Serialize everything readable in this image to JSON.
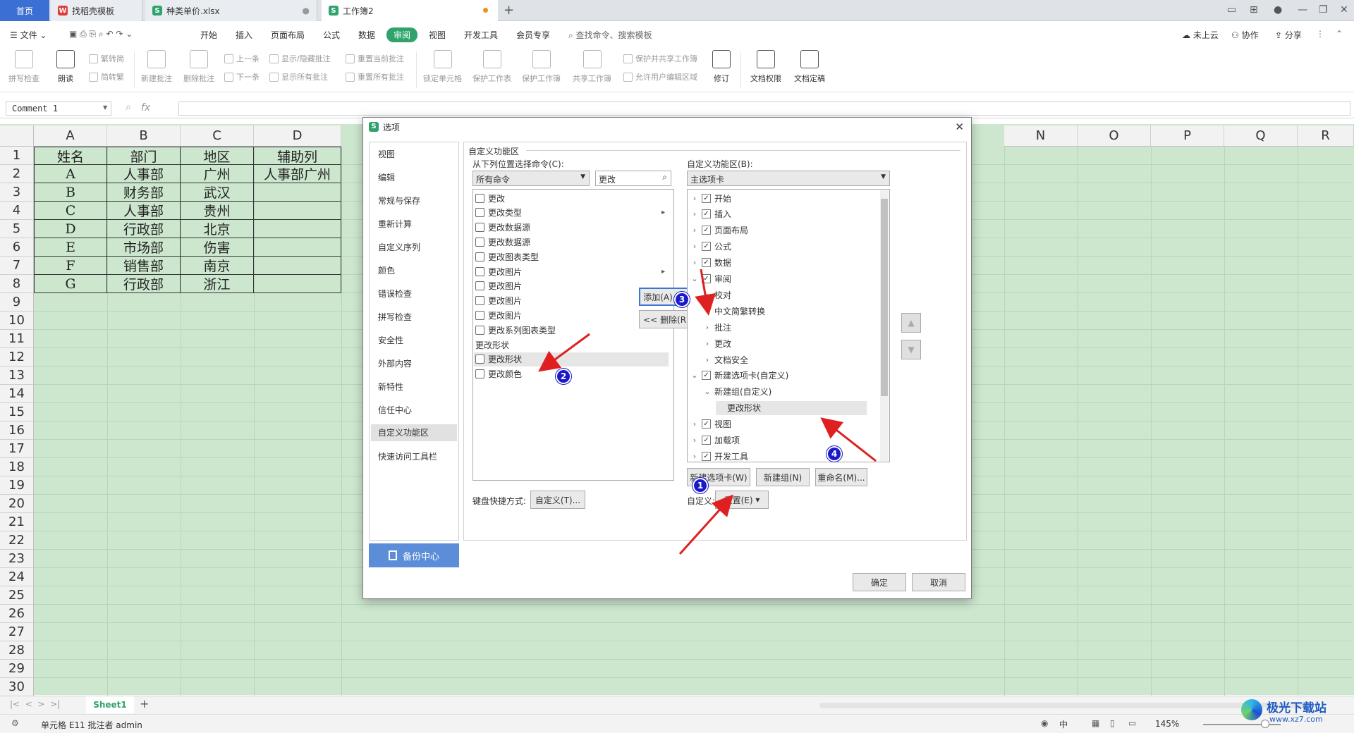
{
  "tabs": [
    {
      "label": "首页"
    },
    {
      "label": "找稻壳模板"
    },
    {
      "label": "种类单价.xlsx"
    },
    {
      "label": "工作簿2"
    }
  ],
  "menus": [
    "文件",
    "开始",
    "插入",
    "页面布局",
    "公式",
    "数据",
    "审阅",
    "视图",
    "开发工具",
    "会员专享"
  ],
  "search_hint": "查找命令、搜索模板",
  "top_right": {
    "cloud": "未上云",
    "collab": "协作",
    "share": "分享"
  },
  "ribbon": {
    "spell": "拼写检查",
    "read": "朗读",
    "trad": "繁转简",
    "simp": "简转繁",
    "new_comment": "新建批注",
    "del_comment": "删除批注",
    "prev": "上一条",
    "next": "下一条",
    "show_hide": "显示/隐藏批注",
    "show_all": "显示所有批注",
    "reset_cur": "重置当前批注",
    "reset_all": "重置所有批注",
    "lock_cell": "锁定单元格",
    "protect_sheet": "保护工作表",
    "protect_book": "保护工作簿",
    "share_book": "共享工作簿",
    "protect_share": "保护并共享工作簿",
    "allow_edit": "允许用户编辑区域",
    "revise": "修订",
    "doc_perm": "文档权限",
    "doc_final": "文档定稿"
  },
  "formula": {
    "namebox": "Comment 1",
    "fx": "fx"
  },
  "columns": [
    "A",
    "B",
    "C",
    "D",
    "N",
    "O",
    "P",
    "Q",
    "R"
  ],
  "rows": [
    "1",
    "2",
    "3",
    "4",
    "5",
    "6",
    "7",
    "8",
    "9",
    "10",
    "11",
    "12",
    "13",
    "14",
    "15",
    "16",
    "17",
    "18",
    "19",
    "20",
    "21",
    "22",
    "23",
    "24",
    "25",
    "26",
    "27",
    "28",
    "29",
    "30"
  ],
  "table": [
    [
      "姓名",
      "部门",
      "地区",
      "辅助列"
    ],
    [
      "A",
      "人事部",
      "广州",
      "人事部广州"
    ],
    [
      "B",
      "财务部",
      "武汉",
      ""
    ],
    [
      "C",
      "人事部",
      "贵州",
      ""
    ],
    [
      "D",
      "行政部",
      "北京",
      ""
    ],
    [
      "E",
      "市场部",
      "伤害",
      ""
    ],
    [
      "F",
      "销售部",
      "南京",
      ""
    ],
    [
      "G",
      "行政部",
      "浙江",
      ""
    ]
  ],
  "sheet_tab": "Sheet1",
  "status": {
    "cell": "单元格 E11 批注者 admin",
    "zoom": "145%",
    "ime": "中"
  },
  "watermark": {
    "name": "极光下载站",
    "url": "www.xz7.com"
  },
  "dialog": {
    "title": "选项",
    "nav": [
      "视图",
      "编辑",
      "常规与保存",
      "重新计算",
      "自定义序列",
      "颜色",
      "错误检查",
      "拼写检查",
      "安全性",
      "外部内容",
      "新特性",
      "信任中心",
      "自定义功能区",
      "快速访问工具栏"
    ],
    "backup": "备份中心",
    "section": "自定义功能区",
    "left_label": "从下列位置选择命令(C):",
    "left_combo": "所有命令",
    "left_search": "更改",
    "left_items": [
      "更改",
      "更改类型",
      "更改数据源",
      "更改数据源",
      "更改图表类型",
      "更改图片",
      "更改图片",
      "更改图片",
      "更改图片",
      "更改系列图表类型",
      "更改形状",
      "更改形状",
      "更改颜色"
    ],
    "right_label": "自定义功能区(B):",
    "right_combo": "主选项卡",
    "tree": [
      "开始",
      "插入",
      "页面布局",
      "公式",
      "数据",
      "审阅",
      "校对",
      "中文简繁转换",
      "批注",
      "更改",
      "文档安全",
      "新建选项卡(自定义)",
      "新建组(自定义)",
      "更改形状",
      "视图",
      "加载项",
      "开发工具"
    ],
    "add": "添加(A) >>",
    "remove": "<< 删除(R)",
    "new_tab": "新建选项卡(W)",
    "new_group": "新建组(N)",
    "rename": "重命名(M)...",
    "custom_label": "自定义:",
    "reset": "重置(E)",
    "kb_label": "键盘快捷方式:",
    "kb_btn": "自定义(T)...",
    "ok": "确定",
    "cancel": "取消"
  },
  "annotations": [
    "1",
    "2",
    "3",
    "4"
  ],
  "colors": {
    "accent": "#2fa36b",
    "sheet_bg": "#cde7cf",
    "badge": "#1a1ac8",
    "arrow": "#e02020"
  }
}
